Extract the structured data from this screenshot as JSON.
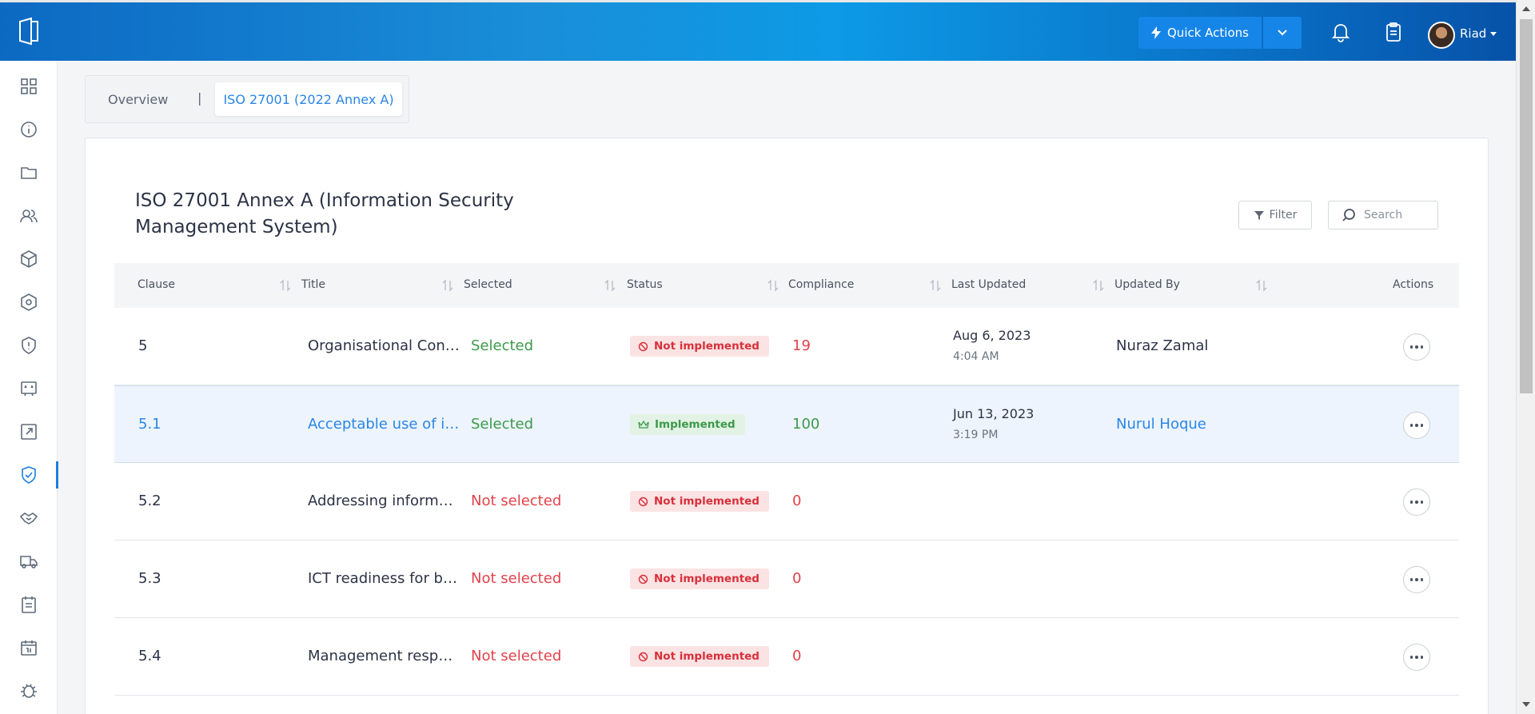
{
  "header": {
    "quick_actions_label": "Quick Actions",
    "user_name": "Riad",
    "colors": {
      "accent": "#1685e8",
      "gradient_start": "#0c69c2",
      "gradient_end": "#0652a8"
    }
  },
  "sidebar": {
    "items": [
      {
        "icon": "grid-icon"
      },
      {
        "icon": "info-icon"
      },
      {
        "icon": "folder-icon"
      },
      {
        "icon": "users-icon"
      },
      {
        "icon": "cube-icon"
      },
      {
        "icon": "hexagon-icon"
      },
      {
        "icon": "alert-shield-icon"
      },
      {
        "icon": "rating-board-icon"
      },
      {
        "icon": "external-link-icon"
      },
      {
        "icon": "shield-check-icon",
        "active": true
      },
      {
        "icon": "handshake-icon"
      },
      {
        "icon": "truck-icon"
      },
      {
        "icon": "checklist-icon"
      },
      {
        "icon": "calendar-icon"
      },
      {
        "icon": "bug-icon"
      }
    ]
  },
  "tabs": {
    "overview": "Overview",
    "separator": "|",
    "active": "ISO 27001 (2022 Annex A)"
  },
  "card": {
    "title": "ISO 27001 Annex A (Information Security Management System)",
    "filter_label": "Filter",
    "search_placeholder": "Search"
  },
  "table": {
    "columns": [
      "Clause",
      "Title",
      "Selected",
      "Status",
      "Compliance",
      "Last Updated",
      "Updated By",
      "Actions"
    ],
    "rows": [
      {
        "clause": "5",
        "title": "Organisational Controls",
        "selected": "Selected",
        "status": "Not implemented",
        "compliance": "19",
        "date": "Aug 6, 2023",
        "time": "4:04 AM",
        "updated_by": "Nuraz Zamal"
      },
      {
        "clause": "5.1",
        "title": "Acceptable use of information",
        "selected": "Selected",
        "status": "Implemented",
        "compliance": "100",
        "date": "Jun 13, 2023",
        "time": "3:19 PM",
        "updated_by": "Nurul Hoque"
      },
      {
        "clause": "5.2",
        "title": "Addressing information security",
        "selected": "Not selected",
        "status": "Not implemented",
        "compliance": "0",
        "date": "",
        "time": "",
        "updated_by": ""
      },
      {
        "clause": "5.3",
        "title": "ICT readiness for business continuity",
        "selected": "Not selected",
        "status": "Not implemented",
        "compliance": "0",
        "date": "",
        "time": "",
        "updated_by": ""
      },
      {
        "clause": "5.4",
        "title": "Management responsibilities",
        "selected": "Not selected",
        "status": "Not implemented",
        "compliance": "0",
        "date": "",
        "time": "",
        "updated_by": ""
      }
    ]
  }
}
